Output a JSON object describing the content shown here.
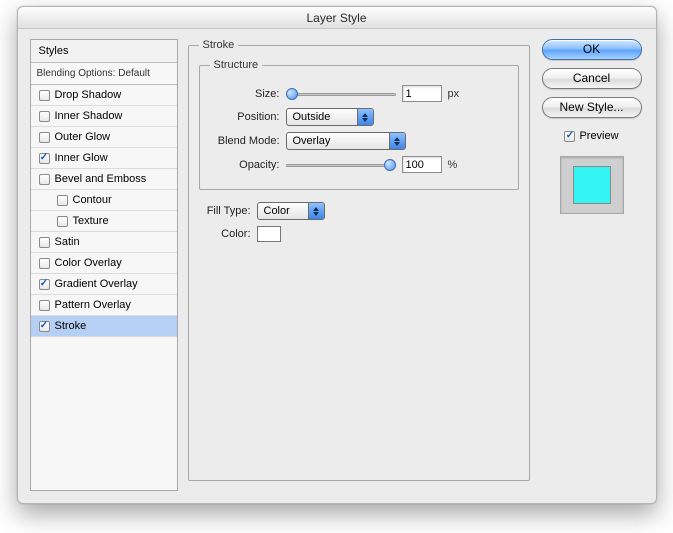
{
  "title": "Layer Style",
  "styles_header": "Styles",
  "blending_label": "Blending Options: Default",
  "style_items": [
    {
      "label": "Drop Shadow",
      "checked": false
    },
    {
      "label": "Inner Shadow",
      "checked": false
    },
    {
      "label": "Outer Glow",
      "checked": false
    },
    {
      "label": "Inner Glow",
      "checked": true
    },
    {
      "label": "Bevel and Emboss",
      "checked": false
    },
    {
      "label": "Contour",
      "checked": false,
      "indent": true
    },
    {
      "label": "Texture",
      "checked": false,
      "indent": true
    },
    {
      "label": "Satin",
      "checked": false
    },
    {
      "label": "Color Overlay",
      "checked": false
    },
    {
      "label": "Gradient Overlay",
      "checked": true
    },
    {
      "label": "Pattern Overlay",
      "checked": false
    },
    {
      "label": "Stroke",
      "checked": true,
      "selected": true
    }
  ],
  "group_title": "Stroke",
  "structure_title": "Structure",
  "labels": {
    "size": "Size:",
    "position": "Position:",
    "blend": "Blend Mode:",
    "opacity": "Opacity:",
    "filltype": "Fill Type:",
    "color": "Color:",
    "px": "px",
    "pct": "%"
  },
  "values": {
    "size": "1",
    "position": "Outside",
    "blend": "Overlay",
    "opacity": "100",
    "filltype": "Color",
    "color_swatch": "#ffffff",
    "preview_color": "#35f4f4"
  },
  "buttons": {
    "ok": "OK",
    "cancel": "Cancel",
    "newstyle": "New Style...",
    "preview": "Preview"
  }
}
